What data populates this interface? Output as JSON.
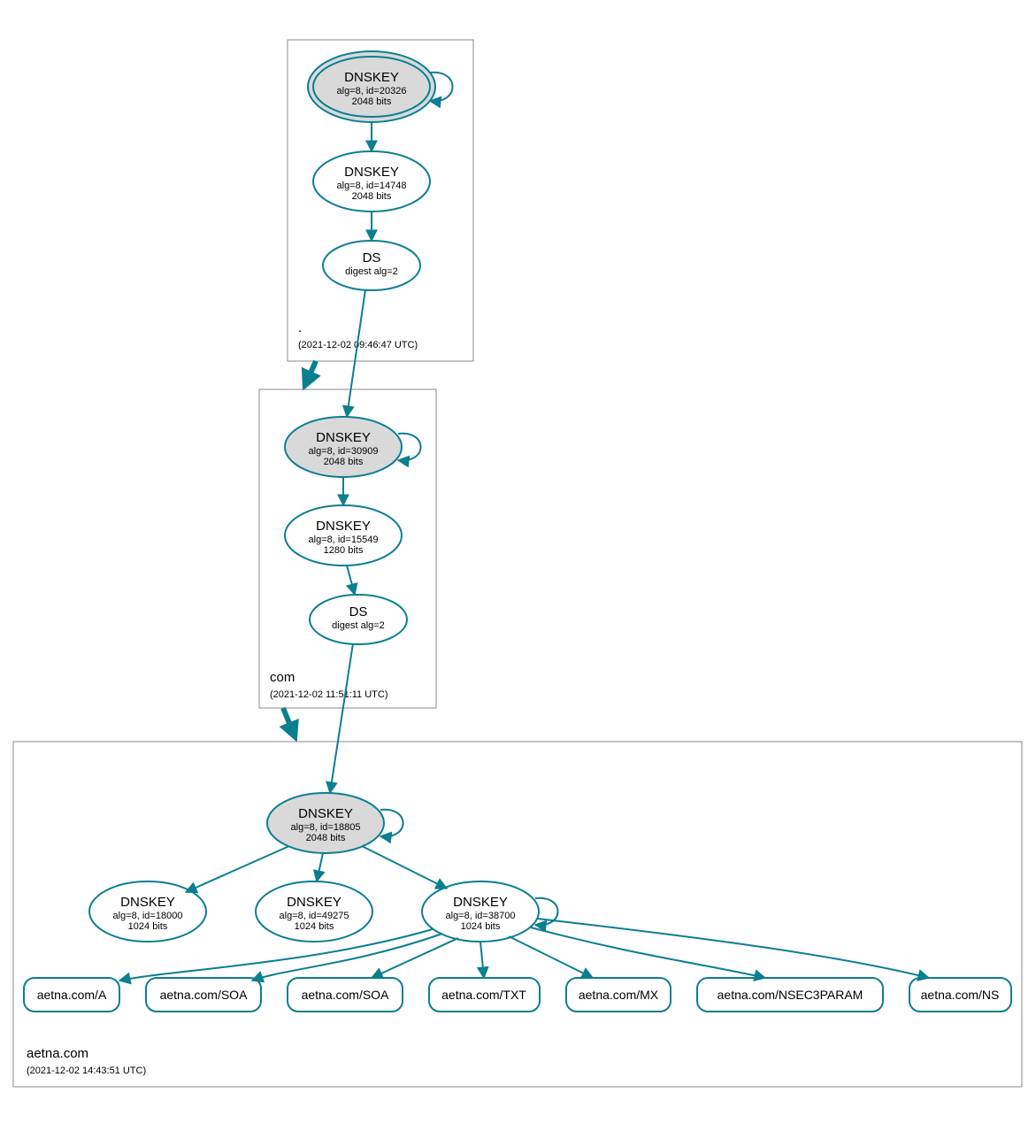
{
  "colors": {
    "stroke": "#0b7f90",
    "ksk_fill": "#d9d9d9"
  },
  "zones": {
    "root": {
      "name": ".",
      "timestamp": "(2021-12-02 09:46:47 UTC)"
    },
    "com": {
      "name": "com",
      "timestamp": "(2021-12-02 11:51:11 UTC)"
    },
    "aetna": {
      "name": "aetna.com",
      "timestamp": "(2021-12-02 14:43:51 UTC)"
    }
  },
  "nodes": {
    "root_ksk": {
      "title": "DNSKEY",
      "line2": "alg=8, id=20326",
      "line3": "2048 bits"
    },
    "root_zsk": {
      "title": "DNSKEY",
      "line2": "alg=8, id=14748",
      "line3": "2048 bits"
    },
    "root_ds": {
      "title": "DS",
      "line2": "digest alg=2",
      "line3": ""
    },
    "com_ksk": {
      "title": "DNSKEY",
      "line2": "alg=8, id=30909",
      "line3": "2048 bits"
    },
    "com_zsk": {
      "title": "DNSKEY",
      "line2": "alg=8, id=15549",
      "line3": "1280 bits"
    },
    "com_ds": {
      "title": "DS",
      "line2": "digest alg=2",
      "line3": ""
    },
    "aet_ksk": {
      "title": "DNSKEY",
      "line2": "alg=8, id=18805",
      "line3": "2048 bits"
    },
    "aet_zsk1": {
      "title": "DNSKEY",
      "line2": "alg=8, id=18000",
      "line3": "1024 bits"
    },
    "aet_zsk2": {
      "title": "DNSKEY",
      "line2": "alg=8, id=49275",
      "line3": "1024 bits"
    },
    "aet_zsk3": {
      "title": "DNSKEY",
      "line2": "alg=8, id=38700",
      "line3": "1024 bits"
    }
  },
  "rrsets": {
    "a": "aetna.com/A",
    "soa1": "aetna.com/SOA",
    "soa2": "aetna.com/SOA",
    "txt": "aetna.com/TXT",
    "mx": "aetna.com/MX",
    "nsec": "aetna.com/NSEC3PARAM",
    "ns": "aetna.com/NS"
  }
}
